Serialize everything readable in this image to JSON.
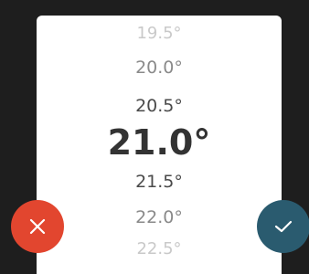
{
  "temperature_picker": {
    "values": [
      "19.5°",
      "20.0°",
      "20.5°",
      "21.0°",
      "21.5°",
      "22.0°",
      "22.5°"
    ],
    "selected_index": 3
  },
  "buttons": {
    "cancel_icon": "close-icon",
    "confirm_icon": "check-icon"
  },
  "colors": {
    "background": "#1e1e1e",
    "card": "#ffffff",
    "cancel": "#e2462f",
    "confirm": "#2a5b6f"
  }
}
